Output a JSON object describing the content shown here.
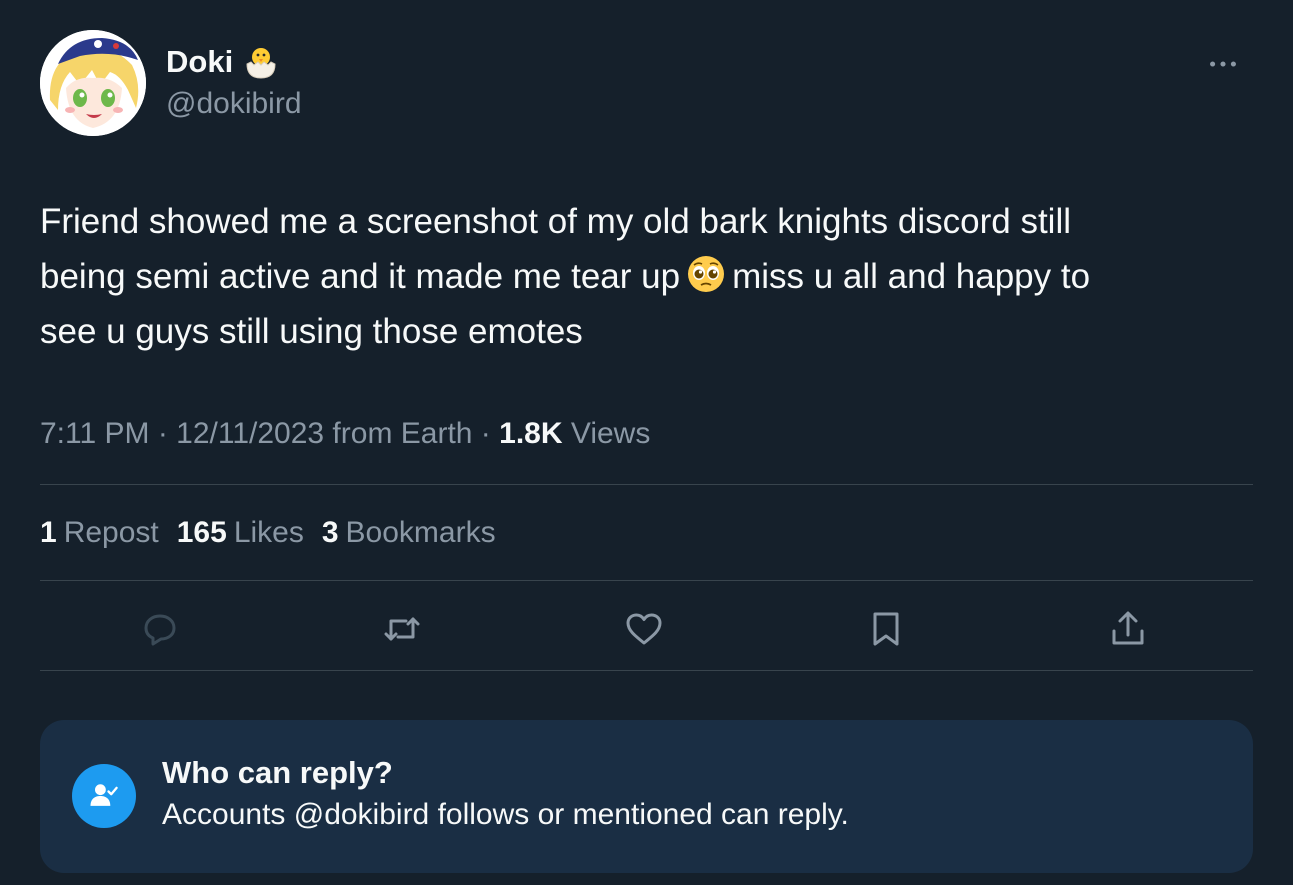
{
  "author": {
    "display_name": "Doki",
    "name_emoji": "hatching-chick-icon",
    "handle": "@dokibird"
  },
  "tweet": {
    "lines": [
      "Friend showed me a screenshot of my old bark knights discord still",
      "being semi active and it made me tear up",
      "miss u all and happy to",
      "see u guys still using those emotes"
    ],
    "inline_emoji": "pleading-face-icon"
  },
  "meta": {
    "time": "7:11 PM",
    "sep1": " · ",
    "date": "12/11/2023",
    "location": " from Earth",
    "sep2": " · ",
    "views_count": "1.8K",
    "views_label": "Views"
  },
  "stats": {
    "reposts_count": "1",
    "reposts_label": "Repost",
    "likes_count": "165",
    "likes_label": "Likes",
    "bookmarks_count": "3",
    "bookmarks_label": "Bookmarks"
  },
  "actions": [
    "reply-icon",
    "repost-icon",
    "like-icon",
    "bookmark-icon",
    "share-icon"
  ],
  "who_can_reply": {
    "title": "Who can reply?",
    "description": "Accounts @dokibird follows or mentioned can reply."
  },
  "colors": {
    "background": "#15202b",
    "text_primary": "#f7f9f9",
    "text_secondary": "#8b98a5",
    "divider": "#38444d",
    "accent": "#1d9bf0",
    "reply_box": "#1a2e44"
  }
}
